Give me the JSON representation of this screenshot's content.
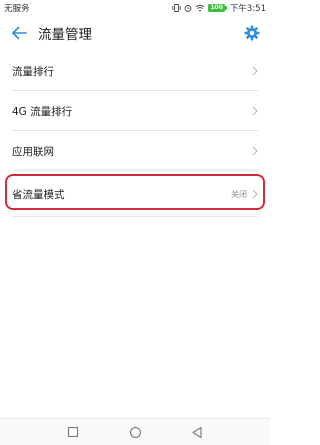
{
  "status_bar": {
    "carrier": "无服务",
    "battery": "100",
    "time": "下午3:51",
    "icons": [
      "vibrate-icon",
      "alarm-icon",
      "wifi-icon",
      "battery-icon"
    ]
  },
  "header": {
    "title": "流量管理",
    "back_icon": "back-arrow-icon",
    "settings_icon": "gear-icon",
    "accent_color": "#2f8bdc"
  },
  "list": {
    "items": [
      {
        "label": "流量排行",
        "value": ""
      },
      {
        "label": "4G 流量排行",
        "value": ""
      },
      {
        "label": "应用联网",
        "value": ""
      },
      {
        "label": "省流量模式",
        "value": "关闭"
      }
    ]
  },
  "highlight_color": "#d42a3a",
  "nav_bar": {
    "icons": [
      "recent-apps-icon",
      "home-icon",
      "back-icon"
    ]
  }
}
